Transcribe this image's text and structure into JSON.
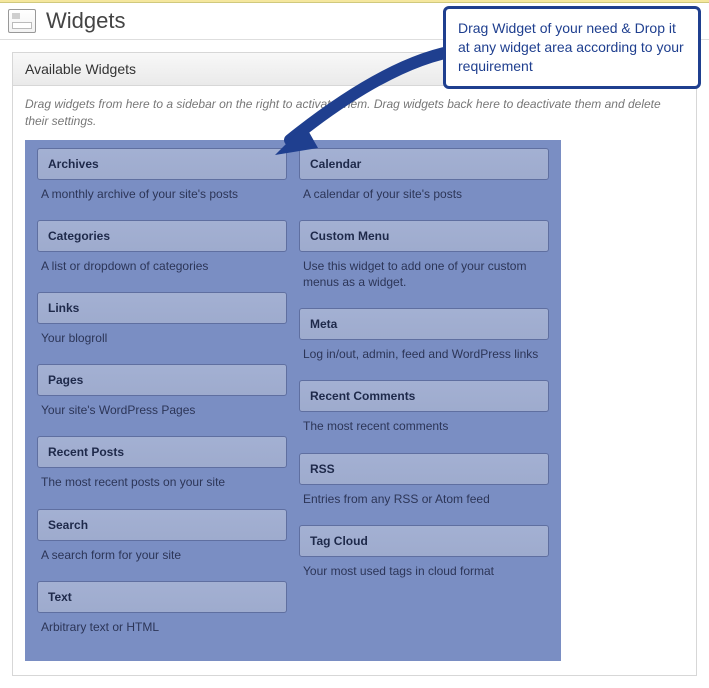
{
  "page": {
    "title": "Widgets"
  },
  "panel": {
    "heading": "Available Widgets",
    "help": "Drag widgets from here to a sidebar on the right to activate them. Drag widgets back here to deactivate them and delete their settings."
  },
  "callout": {
    "text": "Drag Widget of your need & Drop it at any widget area according to your requirement"
  },
  "widgets": {
    "left": [
      {
        "title": "Archives",
        "desc": "A monthly archive of your site's posts"
      },
      {
        "title": "Categories",
        "desc": "A list or dropdown of categories"
      },
      {
        "title": "Links",
        "desc": "Your blogroll"
      },
      {
        "title": "Pages",
        "desc": "Your site's WordPress Pages"
      },
      {
        "title": "Recent Posts",
        "desc": "The most recent posts on your site"
      },
      {
        "title": "Search",
        "desc": "A search form for your site"
      },
      {
        "title": "Text",
        "desc": "Arbitrary text or HTML"
      }
    ],
    "right": [
      {
        "title": "Calendar",
        "desc": "A calendar of your site's posts"
      },
      {
        "title": "Custom Menu",
        "desc": "Use this widget to add one of your custom menus as a widget."
      },
      {
        "title": "Meta",
        "desc": "Log in/out, admin, feed and WordPress links"
      },
      {
        "title": "Recent Comments",
        "desc": "The most recent comments"
      },
      {
        "title": "RSS",
        "desc": "Entries from any RSS or Atom feed"
      },
      {
        "title": "Tag Cloud",
        "desc": "Your most used tags in cloud format"
      }
    ]
  }
}
